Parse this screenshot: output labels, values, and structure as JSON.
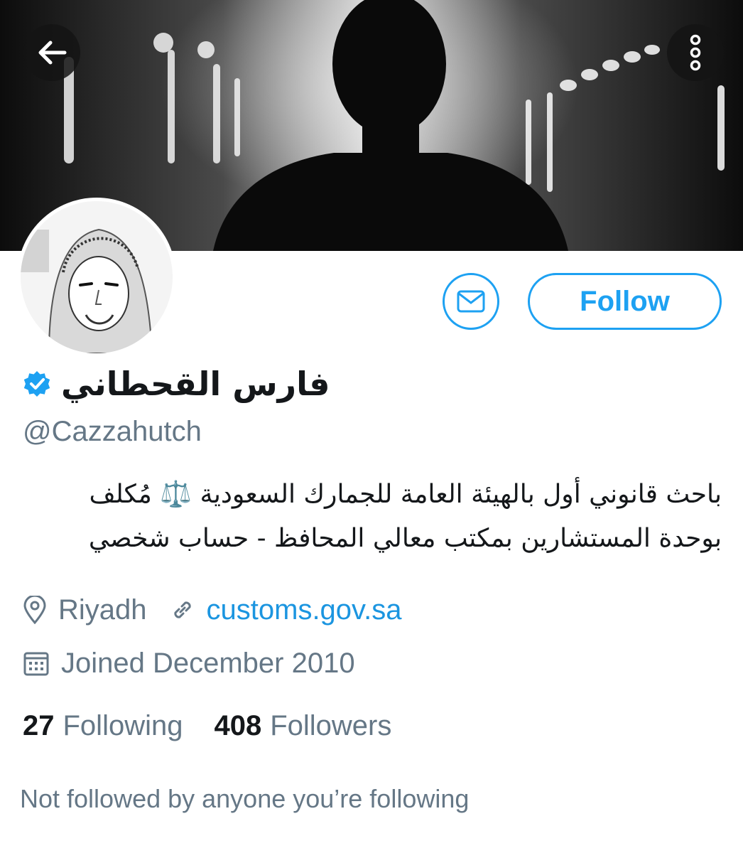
{
  "header": {
    "back_icon": "arrow-left-icon",
    "more_icon": "vertical-ellipsis-icon"
  },
  "profile": {
    "display_name": "فارس القحطاني",
    "verified_icon": "verified-badge-icon",
    "handle": "@Cazzahutch",
    "bio_line1": "باحث قانوني أول بالهيئة العامة للجمارك السعودية ⚖️ مُكلف",
    "bio_line2": "بوحدة المستشارين بمكتب معالي المحافظ - حساب شخصي",
    "location": "Riyadh",
    "website": "customs.gov.sa",
    "joined": "Joined December 2010"
  },
  "actions": {
    "message_icon": "envelope-icon",
    "follow_label": "Follow"
  },
  "stats": {
    "following_count": "27",
    "following_label": "Following",
    "followers_count": "408",
    "followers_label": "Followers"
  },
  "social_context": "Not followed by anyone you’re following",
  "colors": {
    "accent": "#1da1f2",
    "link": "#1b95e0",
    "muted": "#657786",
    "text": "#14171a"
  }
}
